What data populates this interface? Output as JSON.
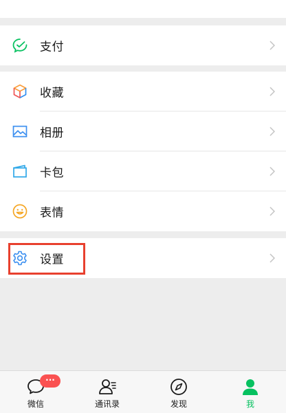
{
  "menu": {
    "pay": "支付",
    "favorites": "收藏",
    "album": "相册",
    "cards": "卡包",
    "stickers": "表情",
    "settings": "设置"
  },
  "tabs": {
    "chats": "微信",
    "contacts": "通讯录",
    "discover": "发现",
    "me": "我"
  },
  "badge": "···",
  "colors": {
    "accent": "#07c160",
    "badge": "#fa5151",
    "highlight": "#e8402e",
    "background": "#ededed"
  },
  "icons": {
    "pay": "pay-check-icon",
    "favorites": "cube-icon",
    "album": "picture-icon",
    "cards": "card-wallet-icon",
    "stickers": "smile-icon",
    "settings": "gear-icon"
  }
}
